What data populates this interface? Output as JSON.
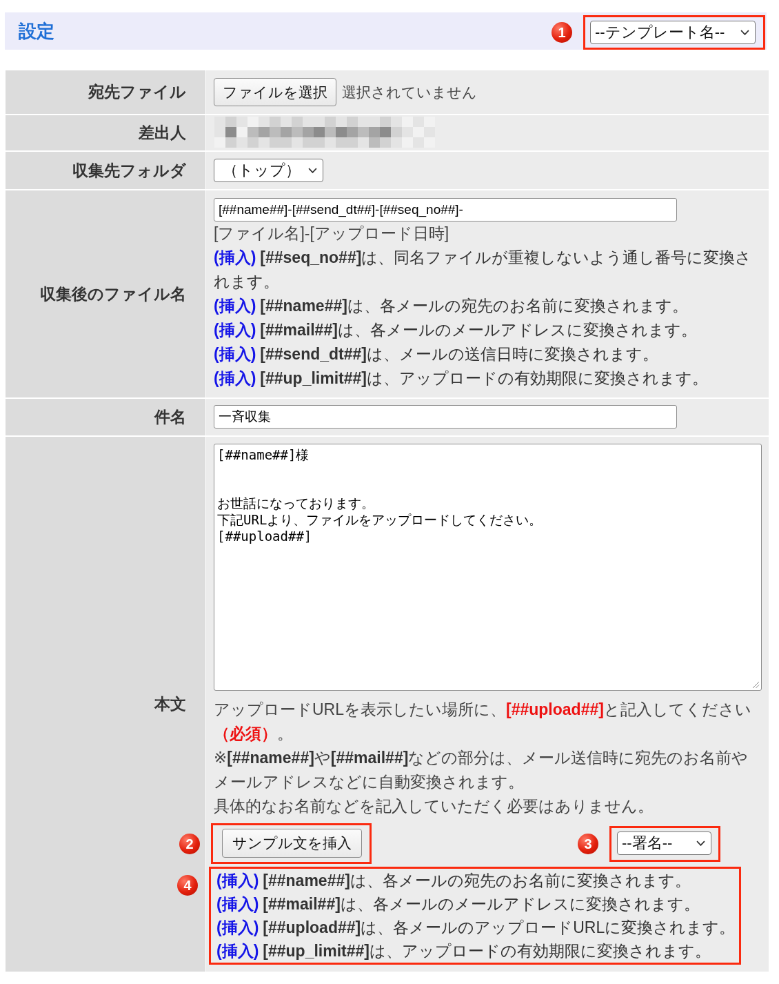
{
  "header": {
    "title": "設定",
    "template_select": {
      "callout": "1",
      "value": "--テンプレート名--"
    }
  },
  "rows": [
    {
      "kind": "file",
      "label": "宛先ファイル",
      "button": "ファイルを選択",
      "status": "選択されていません"
    },
    {
      "kind": "redacted",
      "label": "差出人"
    },
    {
      "kind": "select",
      "label": "収集先フォルダ",
      "value": "（トップ）"
    },
    {
      "kind": "filename",
      "label": "収集後のファイル名",
      "value": "[##name##]-[##send_dt##]-[##seq_no##]-",
      "suffix": "[ファイル名]-[アップロード日時]",
      "help": [
        {
          "link": "(挿入)",
          "text": "**[##seq_no##]**は、同名ファイルが重複しないよう通し番号に変換されます。"
        },
        {
          "link": "(挿入)",
          "text": "**[##name##]**は、各メールの宛先のお名前に変換されます。"
        },
        {
          "link": "(挿入)",
          "text": "**[##mail##]**は、各メールのメールアドレスに変換されます。"
        },
        {
          "link": "(挿入)",
          "text": "**[##send_dt##]**は、メールの送信日時に変換されます。"
        },
        {
          "link": "(挿入)",
          "text": "**[##up_limit##]**は、アップロードの有効期限に変換されます。"
        }
      ]
    },
    {
      "kind": "text",
      "label": "件名",
      "value": "一斉収集"
    },
    {
      "kind": "body",
      "label": "本文",
      "paragraphs": [
        [
          "[##name##]様"
        ],
        [
          "お世話になっております。",
          "下記URLより、ファイルをアップロードしてください。",
          "[##upload##]"
        ]
      ],
      "notes": [
        {
          "kind": "required",
          "text": "アップロードURLを表示したい場所に、**[##upload##]**と記入してください**（必須）**。"
        },
        {
          "kind": "info",
          "text": "※**[##name##]**や**[##mail##]**などの部分は、メール送信時に宛先のお名前やメールアドレスなどに自動変換されます。"
        },
        {
          "kind": "info",
          "text": "具体的なお名前などを記入していただく必要はありません。"
        }
      ],
      "sample_button": {
        "callout": "2",
        "label": "サンプル文を挿入"
      },
      "signature_select": {
        "callout": "3",
        "value": "--署名--"
      },
      "help_callout": "4",
      "help": [
        {
          "link": "(挿入)",
          "text": "**[##name##]**は、各メールの宛先のお名前に変換されます。"
        },
        {
          "link": "(挿入)",
          "text": "**[##mail##]**は、各メールのメールアドレスに変換されます。"
        },
        {
          "link": "(挿入)",
          "text": "**[##upload##]**は、各メールのアップロードURLに変換されます。"
        },
        {
          "link": "(挿入)",
          "text": "**[##up_limit##]**は、アップロードの有効期限に変換されます。"
        }
      ]
    }
  ]
}
